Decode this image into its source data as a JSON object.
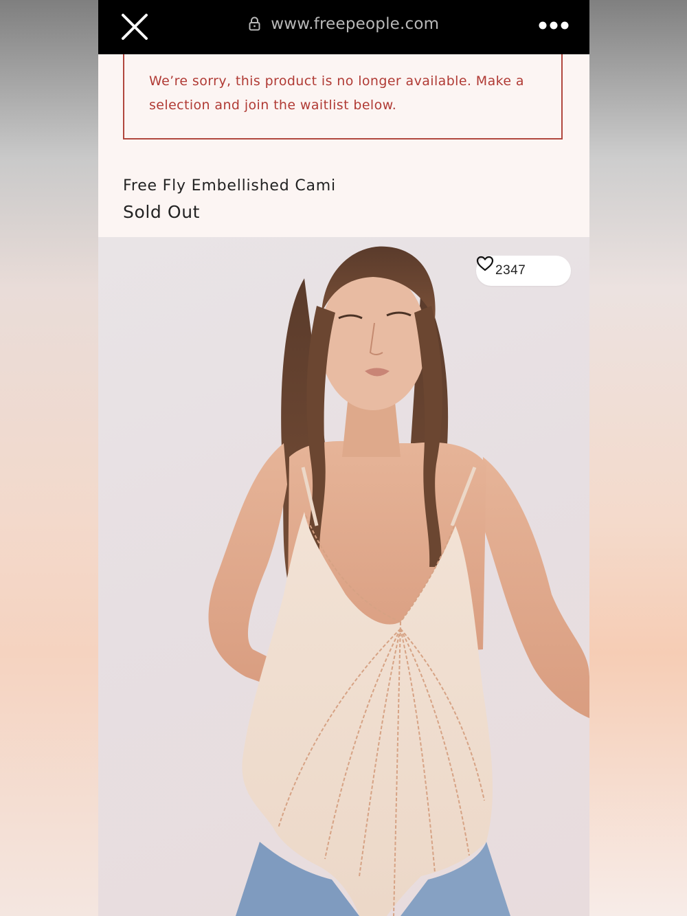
{
  "browser": {
    "url": "www.freepeople.com",
    "close_icon": "close-icon",
    "lock_icon": "lock-icon",
    "menu_icon": "more-horizontal-icon"
  },
  "alert": {
    "line1": "We’re sorry, this product is no longer available. Make a",
    "line2": "selection and join the waitlist below."
  },
  "product": {
    "name": "Free Fly Embellished Cami",
    "status": "Sold Out",
    "image_alt": "Model wearing the Free Fly Embellished Cami"
  },
  "likes": {
    "count": "2347",
    "icon": "heart-icon"
  },
  "colors": {
    "alert_red": "#b03a34",
    "page_bg": "#fcf5f3",
    "urlbar_bg": "#000000"
  }
}
